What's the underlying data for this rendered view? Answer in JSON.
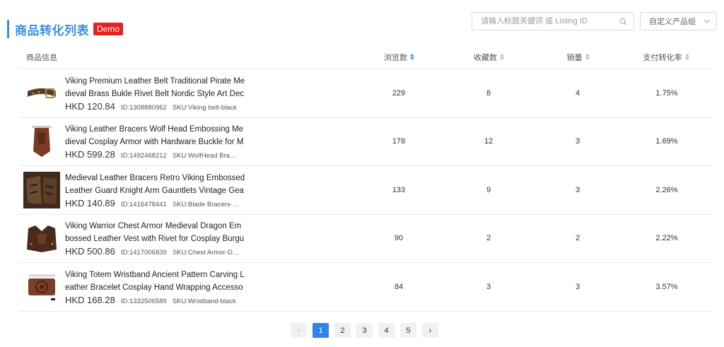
{
  "header": {
    "title": "商品转化列表",
    "badge": "Demo"
  },
  "search": {
    "placeholder": "请输入标题关键词 或 Listing ID"
  },
  "group_select": {
    "value": "自定义产品组"
  },
  "columns": {
    "info": "商品信息",
    "views": "浏览数",
    "favorites": "收藏数",
    "sales": "销量",
    "conversion": "支付转化率"
  },
  "sort_active": "views",
  "rows": [
    {
      "title": "Viking Premium Leather Belt Traditional Pirate Medieval Brass Bukle Rivet Belt Nordic Style Art Deco",
      "price": "HKD 120.84",
      "id": "ID:1308880962",
      "sku": "SKU:Viking belt-black",
      "views": "229",
      "favorites": "8",
      "sales": "4",
      "conversion": "1.75%",
      "thumb": "belt"
    },
    {
      "title": "Viking Leather Bracers Wolf Head Embossing Medieval Cosplay Armor with Hardware Buckle for Men",
      "price": "HKD 599.28",
      "id": "ID:1492468212",
      "sku": "SKU:WolfHead Bracers",
      "views": "178",
      "favorites": "12",
      "sales": "3",
      "conversion": "1.69%",
      "thumb": "bracer"
    },
    {
      "title": "Medieval Leather Bracers Retro Viking Embossed Leather Guard Knight Arm Gauntlets Vintage Gear",
      "price": "HKD 140.89",
      "id": "ID:1416478441",
      "sku": "SKU:Blade Bracers-brown",
      "views": "133",
      "favorites": "9",
      "sales": "3",
      "conversion": "2.26%",
      "thumb": "gauntlet"
    },
    {
      "title": "Viking Warrior Chest Armor Medieval Dragon Embossed Leather Vest with Rivet for Cosplay Burgundy",
      "price": "HKD 500.86",
      "id": "ID:1417006839",
      "sku": "SKU:Chest Armor-Dragon",
      "views": "90",
      "favorites": "2",
      "sales": "2",
      "conversion": "2.22%",
      "thumb": "vest"
    },
    {
      "title": "Viking Totem Wristband Ancient Pattern Carving Leather Bracelet Cosplay Hand Wrapping Accessory",
      "price": "HKD 168.28",
      "id": "ID:1332506589",
      "sku": "SKU:Wristband-black",
      "views": "84",
      "favorites": "3",
      "sales": "3",
      "conversion": "3.57%",
      "thumb": "wristband"
    }
  ],
  "pagination": {
    "prev": "‹",
    "pages": [
      "1",
      "2",
      "3",
      "4",
      "5"
    ],
    "current": "1",
    "next": "›"
  },
  "colors": {
    "accent": "#3b8ee6",
    "badge": "#e8201f",
    "page_active": "#2f83f0"
  }
}
